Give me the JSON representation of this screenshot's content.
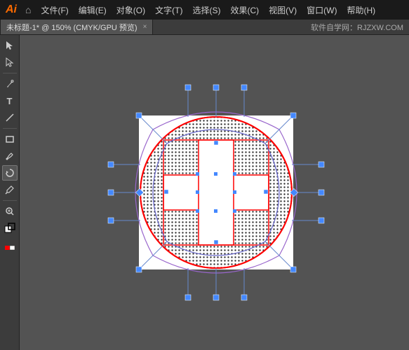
{
  "titlebar": {
    "logo": "Ai",
    "home_icon": "⌂",
    "menu_items": [
      "文件(F)",
      "编辑(E)",
      "对象(O)",
      "文字(T)",
      "选择(S)",
      "效果(C)",
      "视图(V)",
      "窗口(W)",
      "帮助(H)"
    ]
  },
  "tabbar": {
    "active_tab": "未标题-1* @ 150% (CMYK/GPU 预览)",
    "close_icon": "×",
    "website": "软件自学网：RJZXW.COM"
  },
  "toolbar": {
    "tools": [
      {
        "name": "select-tool",
        "icon": "↖",
        "active": false
      },
      {
        "name": "direct-select-tool",
        "icon": "↗",
        "active": false
      },
      {
        "name": "pen-tool",
        "icon": "✒",
        "active": false
      },
      {
        "name": "type-tool",
        "icon": "T",
        "active": false
      },
      {
        "name": "line-tool",
        "icon": "/",
        "active": false
      },
      {
        "name": "rect-tool",
        "icon": "▭",
        "active": false
      },
      {
        "name": "paintbrush-tool",
        "icon": "✦",
        "active": false
      },
      {
        "name": "rotate-tool",
        "icon": "↻",
        "active": true
      },
      {
        "name": "eyedropper-tool",
        "icon": "✐",
        "active": false
      },
      {
        "name": "zoom-tool",
        "icon": "⌕",
        "active": false
      },
      {
        "name": "fill-stroke",
        "icon": "■",
        "active": false
      }
    ]
  }
}
